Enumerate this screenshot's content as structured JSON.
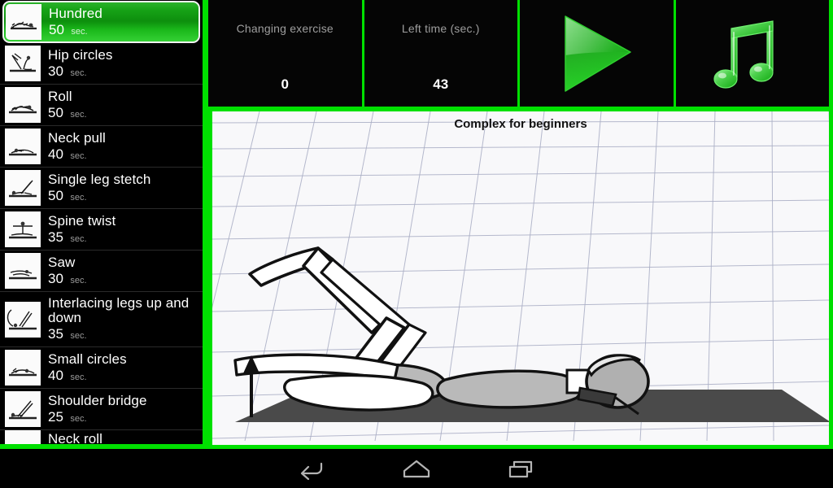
{
  "app": {
    "accent_color": "#00e000",
    "background_color": "#000000"
  },
  "sidebar": {
    "name": "exercise-list",
    "items": [
      {
        "name": "Hundred",
        "duration": "50",
        "unit": "sec.",
        "selected": true,
        "icon": "exercise-hundred-thumb"
      },
      {
        "name": "Hip circles",
        "duration": "30",
        "unit": "sec.",
        "selected": false,
        "icon": "exercise-hip-circles-thumb"
      },
      {
        "name": "Roll",
        "duration": "50",
        "unit": "sec.",
        "selected": false,
        "icon": "exercise-roll-thumb"
      },
      {
        "name": "Neck pull",
        "duration": "40",
        "unit": "sec.",
        "selected": false,
        "icon": "exercise-neck-pull-thumb"
      },
      {
        "name": "Single leg stetch",
        "duration": "50",
        "unit": "sec.",
        "selected": false,
        "icon": "exercise-single-leg-stretch-thumb"
      },
      {
        "name": "Spine twist",
        "duration": "35",
        "unit": "sec.",
        "selected": false,
        "icon": "exercise-spine-twist-thumb"
      },
      {
        "name": "Saw",
        "duration": "30",
        "unit": "sec.",
        "selected": false,
        "icon": "exercise-saw-thumb"
      },
      {
        "name": "Interlacing legs up and down",
        "duration": "35",
        "unit": "sec.",
        "selected": false,
        "icon": "exercise-interlacing-legs-thumb"
      },
      {
        "name": "Small circles",
        "duration": "40",
        "unit": "sec.",
        "selected": false,
        "icon": "exercise-small-circles-thumb"
      },
      {
        "name": "Shoulder bridge",
        "duration": "25",
        "unit": "sec.",
        "selected": false,
        "icon": "exercise-shoulder-bridge-thumb"
      },
      {
        "name": "Neck roll",
        "duration": "",
        "unit": "",
        "selected": false,
        "icon": "exercise-neck-roll-thumb"
      }
    ]
  },
  "topbar": {
    "changing_exercise": {
      "label": "Changing exercise",
      "value": "0"
    },
    "left_time": {
      "label": "Left time (sec.)",
      "value": "43"
    },
    "play_button": {
      "icon": "play-icon"
    },
    "music_button": {
      "icon": "music-note-icon"
    }
  },
  "content": {
    "title": "Complex for beginners",
    "illustration": "pilates-hundred-illustration"
  },
  "navbar": {
    "back": "back-icon",
    "home": "home-icon",
    "recents": "recents-icon"
  }
}
